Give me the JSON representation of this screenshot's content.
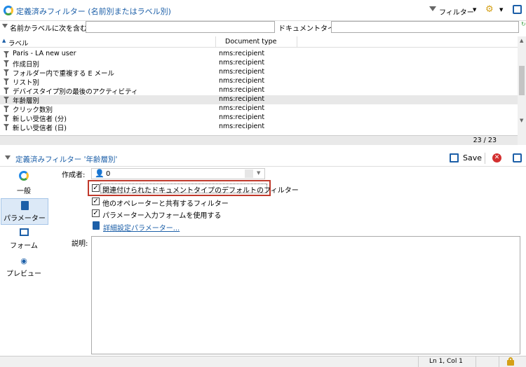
{
  "header": {
    "title": "定義済みフィルター (名前別またはラベル別)",
    "filter_label": "フィルター"
  },
  "search": {
    "name_label": "名前かラベルに次を含む:",
    "name_value": "",
    "doctype_label": "ドキュメントタイプ:",
    "doctype_value": ""
  },
  "list": {
    "columns": [
      "ラベル",
      "Document type"
    ],
    "rows": [
      {
        "label": "Paris - LA new user",
        "doctype": "nms:recipient"
      },
      {
        "label": "作成日別",
        "doctype": "nms:recipient"
      },
      {
        "label": "フォルダー内で重複する E メール",
        "doctype": "nms:recipient"
      },
      {
        "label": "リスト別",
        "doctype": "nms:recipient"
      },
      {
        "label": "デバイスタイプ別の最後のアクティビティ",
        "doctype": "nms:recipient"
      },
      {
        "label": "年齢層別",
        "doctype": "nms:recipient"
      },
      {
        "label": "クリック数別",
        "doctype": "nms:recipient"
      },
      {
        "label": "新しい受信者 (分)",
        "doctype": "nms:recipient"
      },
      {
        "label": "新しい受信者 (日)",
        "doctype": "nms:recipient"
      }
    ],
    "counter": "23 / 23"
  },
  "detail": {
    "title": "定義済みフィルター '年齢層別'",
    "save_label": "Save",
    "tabs": [
      "一般",
      "パラメーター",
      "フォーム",
      "プレビュー"
    ],
    "creator_label": "作成者:",
    "creator_value": "0",
    "checkboxes": [
      "関連付けられたドキュメントタイプのデフォルトのフィルター",
      "他のオペレーターと共有するフィルター",
      "パラメーター入力フォームを使用する"
    ],
    "advanced_link": "詳細設定パラメーター...",
    "description_label": "説明:"
  },
  "status": {
    "position": "Ln 1, Col 1"
  },
  "colors": {
    "accent": "#1c5fa8",
    "highlight_border": "#c0392b",
    "selected_row": "#e8e8e8"
  }
}
